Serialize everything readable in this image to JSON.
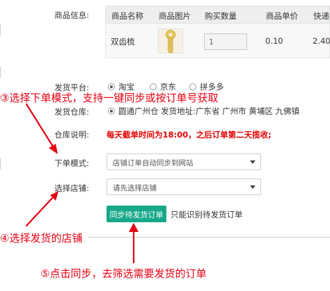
{
  "product": {
    "label": "商品信息:",
    "headers": [
      "商品名称",
      "商品图片",
      "购买数量",
      "商品单价",
      "快递"
    ],
    "row": {
      "name": "双齿梳",
      "quantity": "1",
      "price": "0.10",
      "shipping": "2.40"
    }
  },
  "platform": {
    "label": "发货平台:",
    "options": [
      {
        "label": "淘宝",
        "checked": true
      },
      {
        "label": "京东",
        "checked": false
      },
      {
        "label": "拼多多",
        "checked": false
      }
    ]
  },
  "warehouse": {
    "label": "发货仓库:",
    "value": "圆通广州仓  发货地址:广东省 广州市 黄埔区 九佛镇",
    "checked": true
  },
  "warehouse_note": {
    "label": "仓库说明:",
    "text": "每天截单时间为18:00，之后订单第二天揽收;"
  },
  "order_mode": {
    "label": "下单模式:",
    "selected": "店铺订单自动同步到网站"
  },
  "store": {
    "label": "选择店铺:",
    "selected": "请先选择店铺"
  },
  "sync": {
    "button_label": "同步待发货订单",
    "hint": "只能识别待发货订单"
  },
  "annotations": {
    "step3": "③选择下单模式，支持一键同步或按订单号获取",
    "step4": "④选择发货的店铺",
    "step5": "⑤点击同步，去筛选需要发货的订单"
  },
  "colors": {
    "accent": "#16a889",
    "annotation": "#e60012",
    "warning": "#e60000"
  }
}
